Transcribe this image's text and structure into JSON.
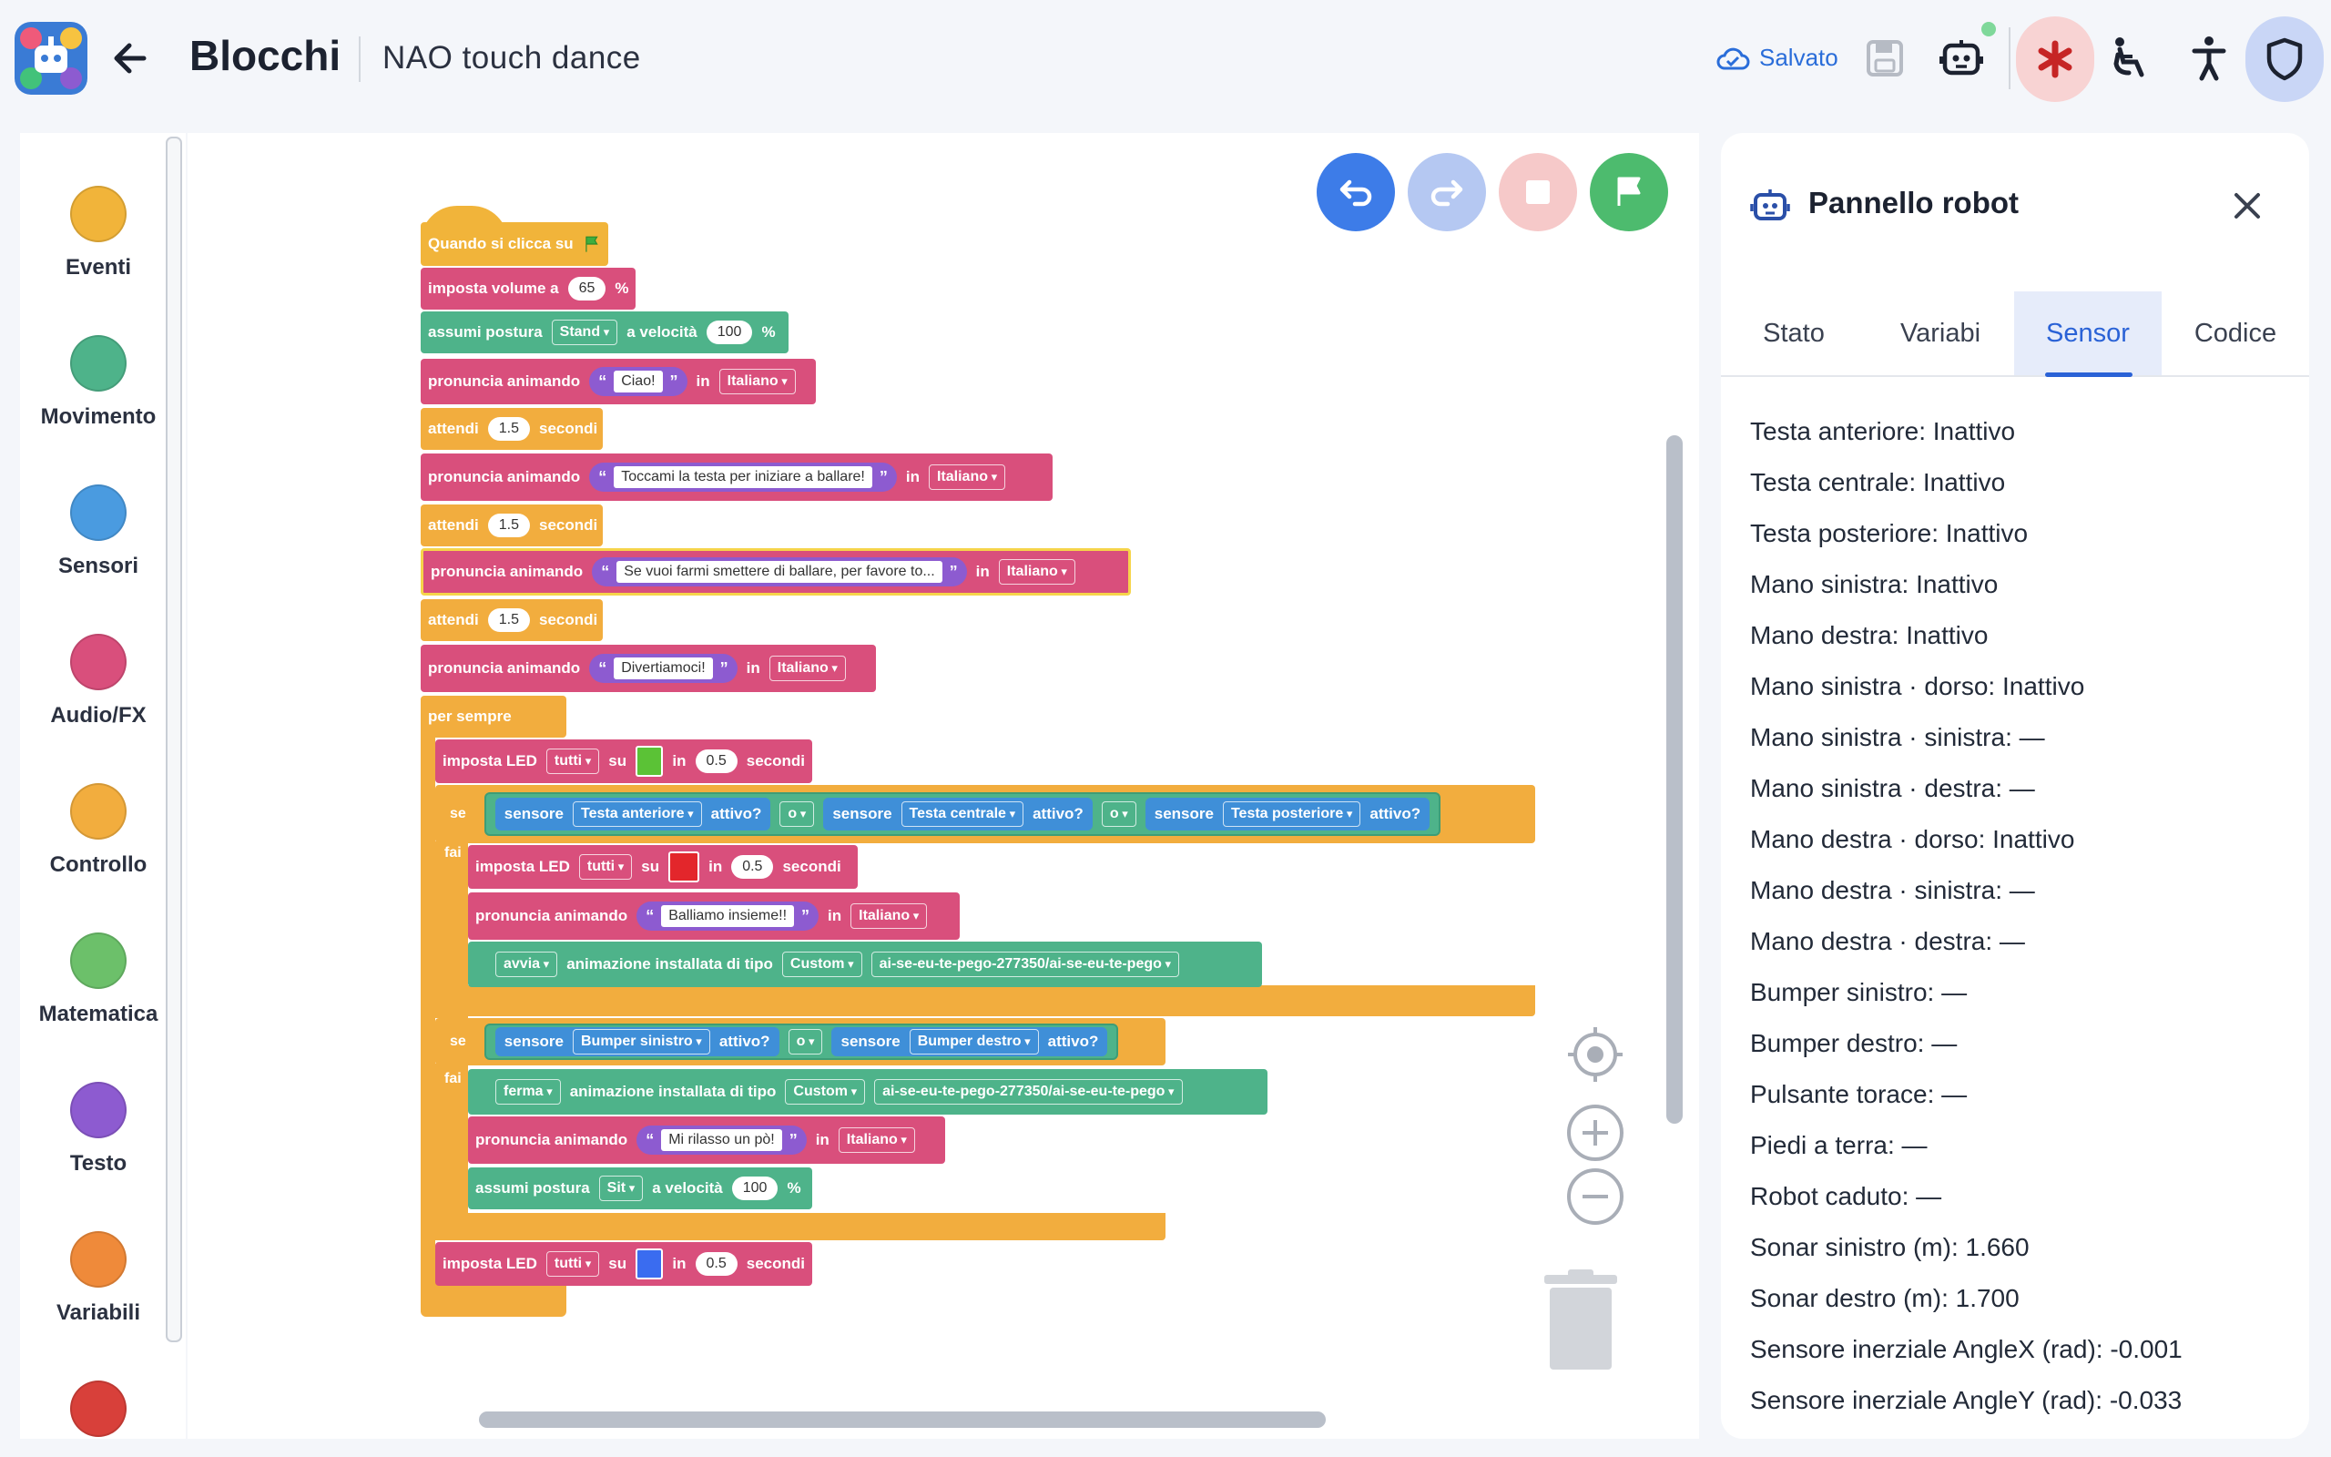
{
  "header": {
    "app_title": "Blocchi",
    "project_name": "NAO touch dance",
    "saved_label": "Salvato",
    "icons": [
      "cloud-check-icon",
      "save-icon",
      "robot-icon",
      "asterisk-icon",
      "wheelchair-icon",
      "accessibility-icon",
      "shield-icon"
    ]
  },
  "palette": {
    "categories": [
      {
        "label": "Eventi",
        "color": "#f1b43a"
      },
      {
        "label": "Movimento",
        "color": "#4eb38a"
      },
      {
        "label": "Sensori",
        "color": "#4a9be0"
      },
      {
        "label": "Audio/FX",
        "color": "#d94f7c"
      },
      {
        "label": "Controllo",
        "color": "#f2ad3e"
      },
      {
        "label": "Matematica",
        "color": "#6cc06a"
      },
      {
        "label": "Testo",
        "color": "#8d5bd0"
      },
      {
        "label": "Variabili",
        "color": "#ef8a3a"
      }
    ]
  },
  "toolbar": {
    "icons": [
      "undo-icon",
      "redo-icon",
      "stop-icon",
      "flag-icon"
    ]
  },
  "blocks": {
    "hat": "Quando si clicca su",
    "volume_prefix": "imposta volume a",
    "volume_value": "65",
    "percent": "%",
    "posture1_prefix": "assumi postura",
    "posture1_value": "Stand",
    "speed_label": "a velocità",
    "speed1": "100",
    "say_label": "pronuncia animando",
    "say1_text": "Ciao!",
    "in_label": "in",
    "lang": "Italiano",
    "wait_label": "attendi",
    "wait_value": "1.5",
    "seconds_label": "secondi",
    "say2_text": "Toccami la testa per iniziare a ballare!",
    "say3_text": "Se vuoi farmi smettere di ballare, per favore to...",
    "say4_text": "Divertiamoci!",
    "forever": "per sempre",
    "led_prefix": "imposta LED",
    "led_target": "tutti",
    "on_label": "su",
    "led_time": "0.5",
    "led_color_green": "#5bc236",
    "led_color_red": "#e3262b",
    "led_color_blue": "#3a6cf0",
    "if_label": "se",
    "do_label": "fai",
    "sensor_label": "sensore",
    "active_label": "attivo?",
    "or_label": "o",
    "sensor_a": "Testa anteriore",
    "sensor_b": "Testa centrale",
    "sensor_c": "Testa posteriore",
    "say5_text": "Balliamo insieme!!",
    "start_label": "avvia",
    "anim_label": "animazione installata di tipo",
    "anim_type": "Custom",
    "anim_name": "ai-se-eu-te-pego-277350/ai-se-eu-te-pego",
    "sensor_d": "Bumper sinistro",
    "sensor_e": "Bumper destro",
    "stop_label": "ferma",
    "say6_text": "Mi rilasso un pò!",
    "posture2_value": "Sit",
    "speed2": "100"
  },
  "panel": {
    "title": "Pannello robot",
    "tabs": [
      {
        "label": "Stato",
        "active": false
      },
      {
        "label": "Variabi",
        "active": false
      },
      {
        "label": "Sensor",
        "active": true
      },
      {
        "label": "Codice",
        "active": false
      }
    ],
    "sensors": [
      "Testa anteriore: Inattivo",
      "Testa centrale: Inattivo",
      "Testa posteriore: Inattivo",
      "Mano sinistra: Inattivo",
      "Mano destra: Inattivo",
      "Mano sinistra · dorso: Inattivo",
      "Mano sinistra · sinistra: —",
      "Mano sinistra · destra: —",
      "Mano destra · dorso: Inattivo",
      "Mano destra · sinistra: —",
      "Mano destra · destra: —",
      "Bumper sinistro: —",
      "Bumper destro: —",
      "Pulsante torace: —",
      "Piedi a terra: —",
      "Robot caduto: —",
      "Sonar sinistro (m): 1.660",
      "Sonar destro (m): 1.700",
      "Sensore inerziale AngleX (rad): -0.001",
      "Sensore inerziale AngleY (rad): -0.033"
    ]
  }
}
